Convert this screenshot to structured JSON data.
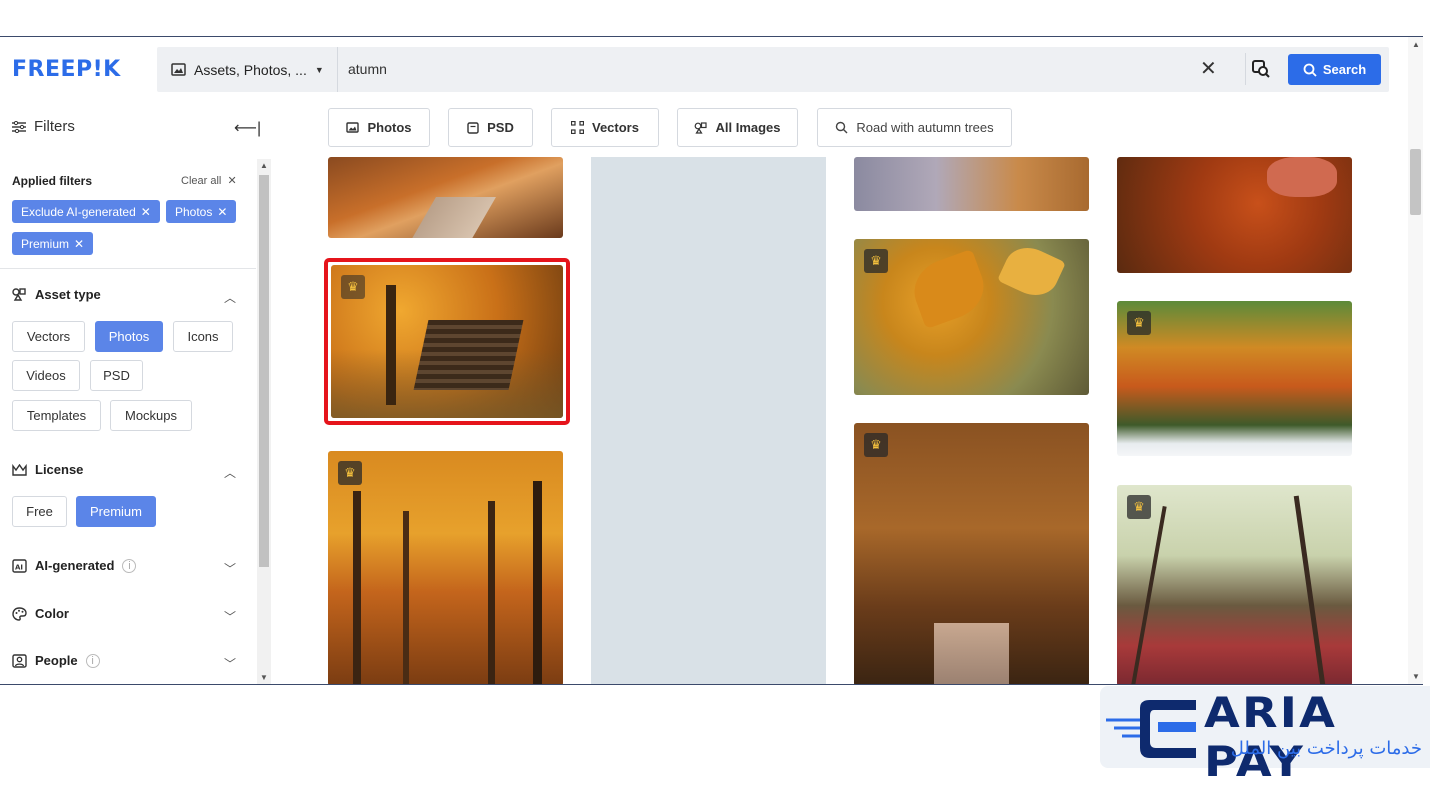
{
  "header": {
    "logo": "FREEP!K",
    "asset_selector": "Assets, Photos, ...",
    "query": "atumn",
    "search_label": "Search"
  },
  "sidebar": {
    "title": "Filters",
    "applied_title": "Applied filters",
    "clear_all": "Clear all",
    "applied": [
      "Exclude AI-generated",
      "Photos",
      "Premium"
    ],
    "asset_type": {
      "title": "Asset type",
      "options": [
        "Vectors",
        "Photos",
        "Icons",
        "Videos",
        "PSD",
        "Templates",
        "Mockups"
      ],
      "selected": "Photos"
    },
    "license": {
      "title": "License",
      "options": [
        "Free",
        "Premium"
      ],
      "selected": "Premium"
    },
    "ai_generated": "AI-generated",
    "color": "Color",
    "people": "People"
  },
  "tabs": [
    "Photos",
    "PSD",
    "Vectors",
    "All Images"
  ],
  "suggestion": "Road with autumn trees",
  "watermark": {
    "brand": "ARIA PAY",
    "tagline": "خدمات پرداخت بین الملل"
  },
  "colors": {
    "accent": "#2c6ce8",
    "chip": "#5b85e8",
    "selected_outline": "#e5141b"
  }
}
